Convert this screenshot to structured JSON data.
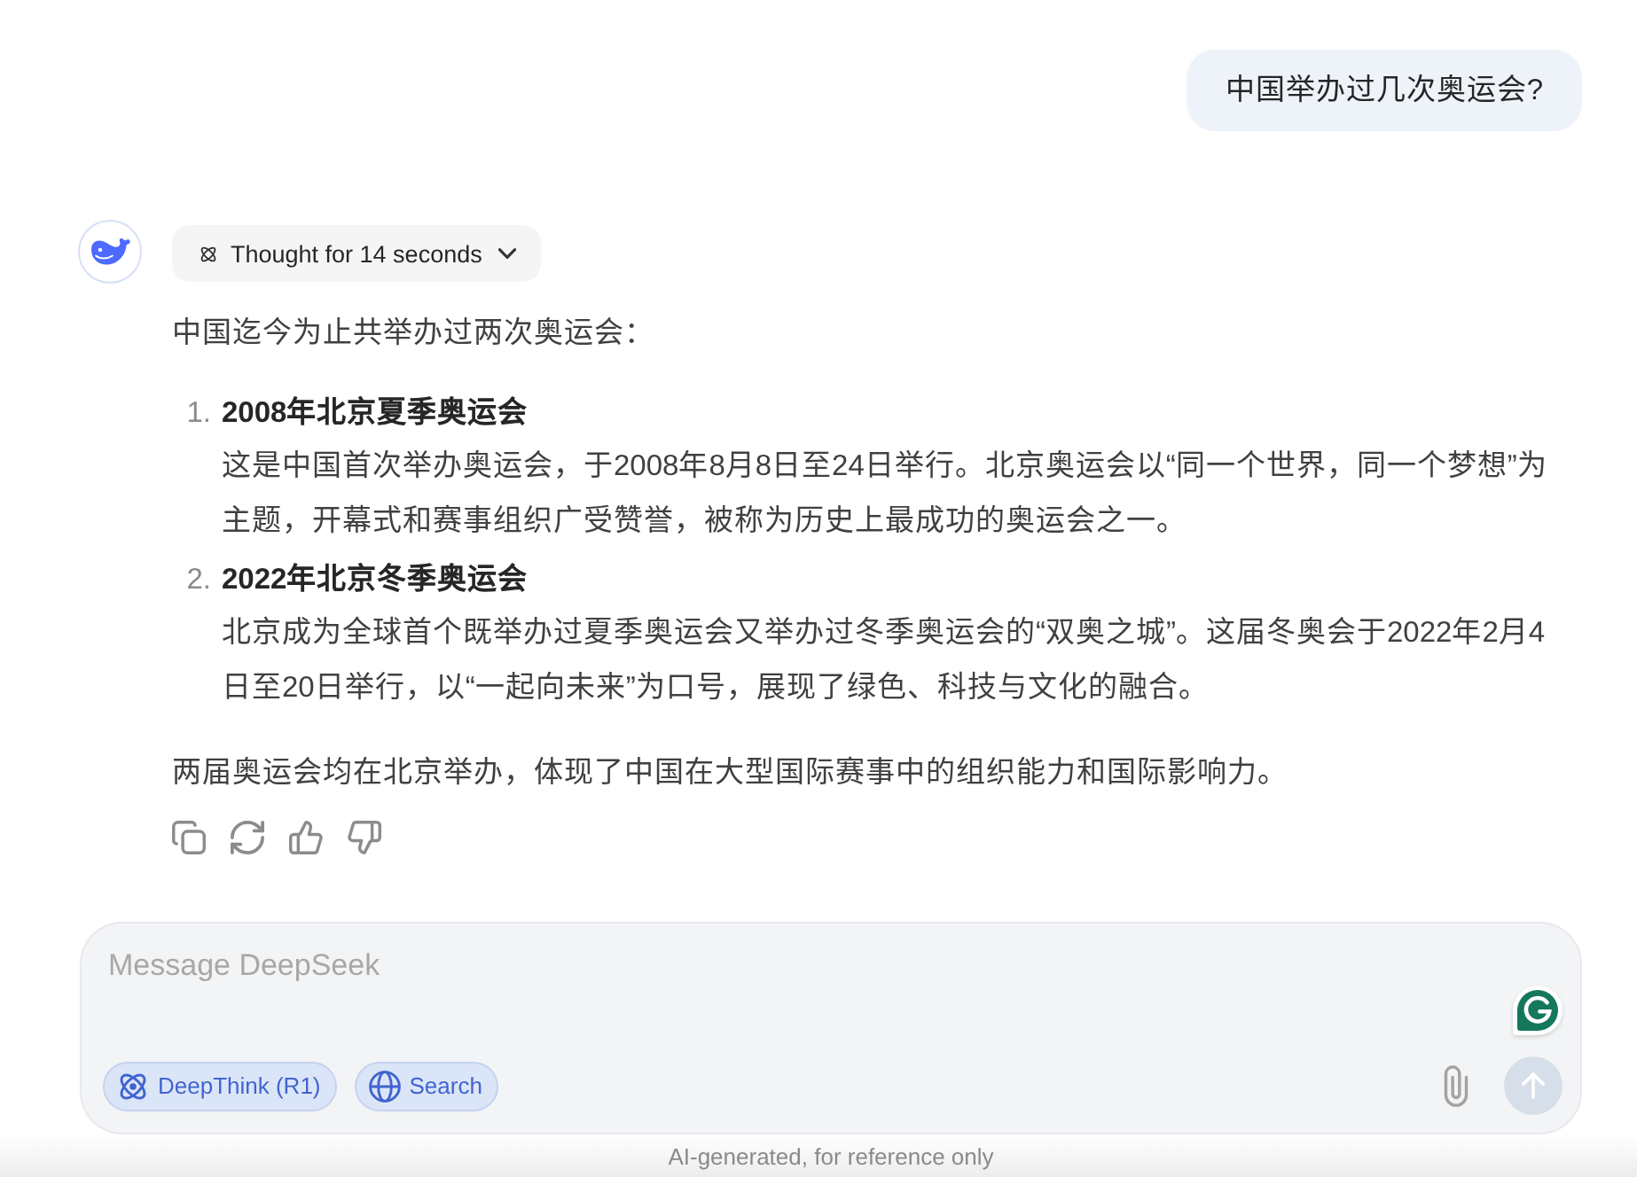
{
  "user_message": {
    "text": "中国举办过几次奥运会?"
  },
  "response": {
    "thought": {
      "label": "Thought for 14 seconds",
      "expanded": false
    },
    "intro": "中国迄今为止共举办过两次奥运会：",
    "items": [
      {
        "marker": "1.",
        "title": "2008年北京夏季奥运会",
        "body": "这是中国首次举办奥运会，于2008年8月8日至24日举行。北京奥运会以“同一个世界，同一个梦想”为主题，开幕式和赛事组织广受赞誉，被称为历史上最成功的奥运会之一。"
      },
      {
        "marker": "2.",
        "title": "2022年北京冬季奥运会",
        "body": "北京成为全球首个既举办过夏季奥运会又举办过冬季奥运会的“双奥之城”。这届冬奥会于2022年2月4日至20日举行，以“一起向未来”为口号，展现了绿色、科技与文化的融合。"
      }
    ],
    "conclusion": "两届奥运会均在北京举办，体现了中国在大型国际赛事中的组织能力和国际影响力。"
  },
  "composer": {
    "placeholder": "Message DeepSeek",
    "toggles": [
      {
        "kind": "think",
        "label": "DeepThink (R1)",
        "selected": true
      },
      {
        "kind": "search",
        "label": "Search",
        "selected": true
      }
    ],
    "send_button": {
      "disabled": true
    }
  },
  "footer": {
    "text": "AI-generated, for reference only"
  }
}
